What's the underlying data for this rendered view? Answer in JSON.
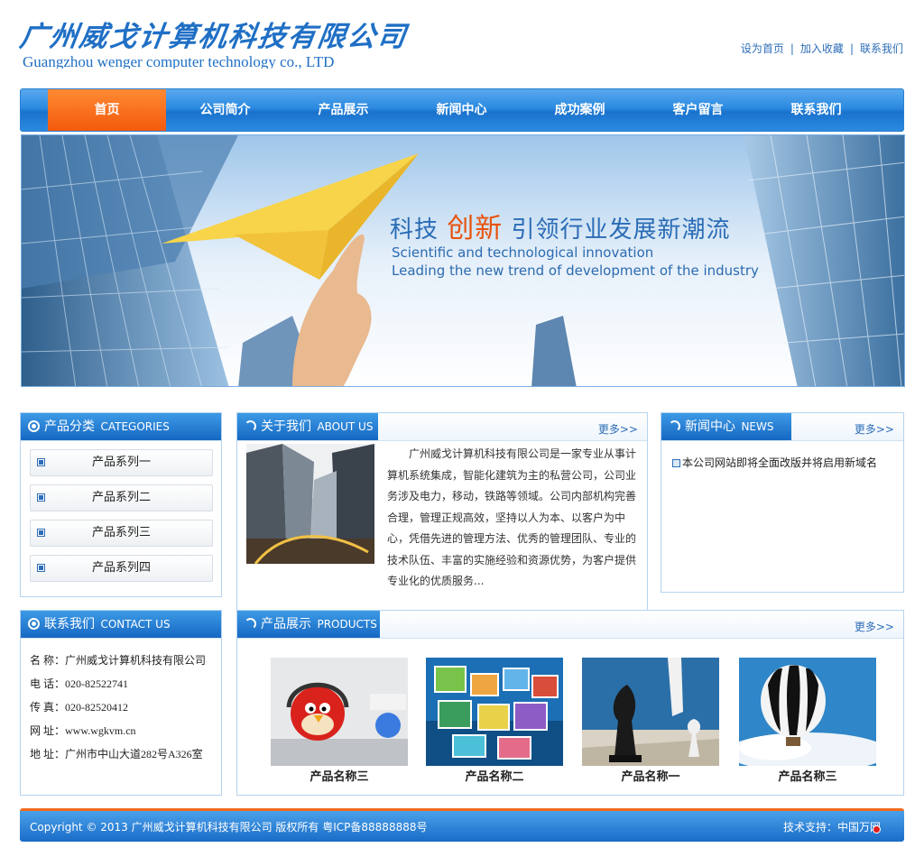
{
  "header": {
    "logo_cn": "广州威戈计算机科技有限公司",
    "logo_en": "Guangzhou wenger computer technology co., LTD",
    "links": [
      "设为首页",
      "加入收藏",
      "联系我们"
    ],
    "separator": "|"
  },
  "nav": {
    "items": [
      "首页",
      "公司简介",
      "产品展示",
      "新闻中心",
      "成功案例",
      "客户留言",
      "联系我们"
    ]
  },
  "banner": {
    "title_a": "科技",
    "title_hl": "创新",
    "title_b": "引领行业发展新潮流",
    "sub1": "Scientific and technological innovation",
    "sub2": "Leading the new trend of development of the industry"
  },
  "categories": {
    "title": "产品分类",
    "title_en": "CATEGORIES",
    "items": [
      "产品系列一",
      "产品系列二",
      "产品系列三",
      "产品系列四"
    ]
  },
  "about": {
    "title": "关于我们",
    "title_en": "ABOUT US",
    "more": "更多>>",
    "text": "广州威戈计算机科技有限公司是一家专业从事计算机系统集成，智能化建筑为主的私营公司，公司业务涉及电力，移动，铁路等领域。公司内部机构完善合理，管理正规高效，坚持以人为本、以客户为中心，凭借先进的管理方法、优秀的管理团队、专业的技术队伍、丰富的实施经验和资源优势，为客户提供专业化的优质服务..."
  },
  "news": {
    "title": "新闻中心",
    "title_en": "NEWS",
    "more": "更多>>",
    "items": [
      "本公司网站即将全面改版并将启用新域名"
    ]
  },
  "contact": {
    "title": "联系我们",
    "title_en": "CONTACT US",
    "lines": [
      "名  称：广州威戈计算机科技有限公司",
      "电  话：020-82522741",
      "传  真：020-82520412",
      "网  址：www.wgkvm.cn",
      "地  址：广州市中山大道282号A326室"
    ]
  },
  "products": {
    "title": "产品展示",
    "title_en": "PRODUCTS",
    "more": "更多>>",
    "items": [
      {
        "name": "产品名称三",
        "icon": "angry-bird-headphones-image"
      },
      {
        "name": "产品名称二",
        "icon": "photo-screens-image"
      },
      {
        "name": "产品名称一",
        "icon": "chess-pieces-image"
      },
      {
        "name": "产品名称三",
        "icon": "hot-air-balloon-image"
      }
    ]
  },
  "footer": {
    "copyright": "Copyright © 2013 广州威戈计算机科技有限公司 版权所有 粤ICP备88888888号",
    "support": "技术支持：中国万网"
  },
  "colors": {
    "primary": "#1f6fc5",
    "nav_active": "#f35a0c",
    "panel_border": "#b6d3ee"
  }
}
